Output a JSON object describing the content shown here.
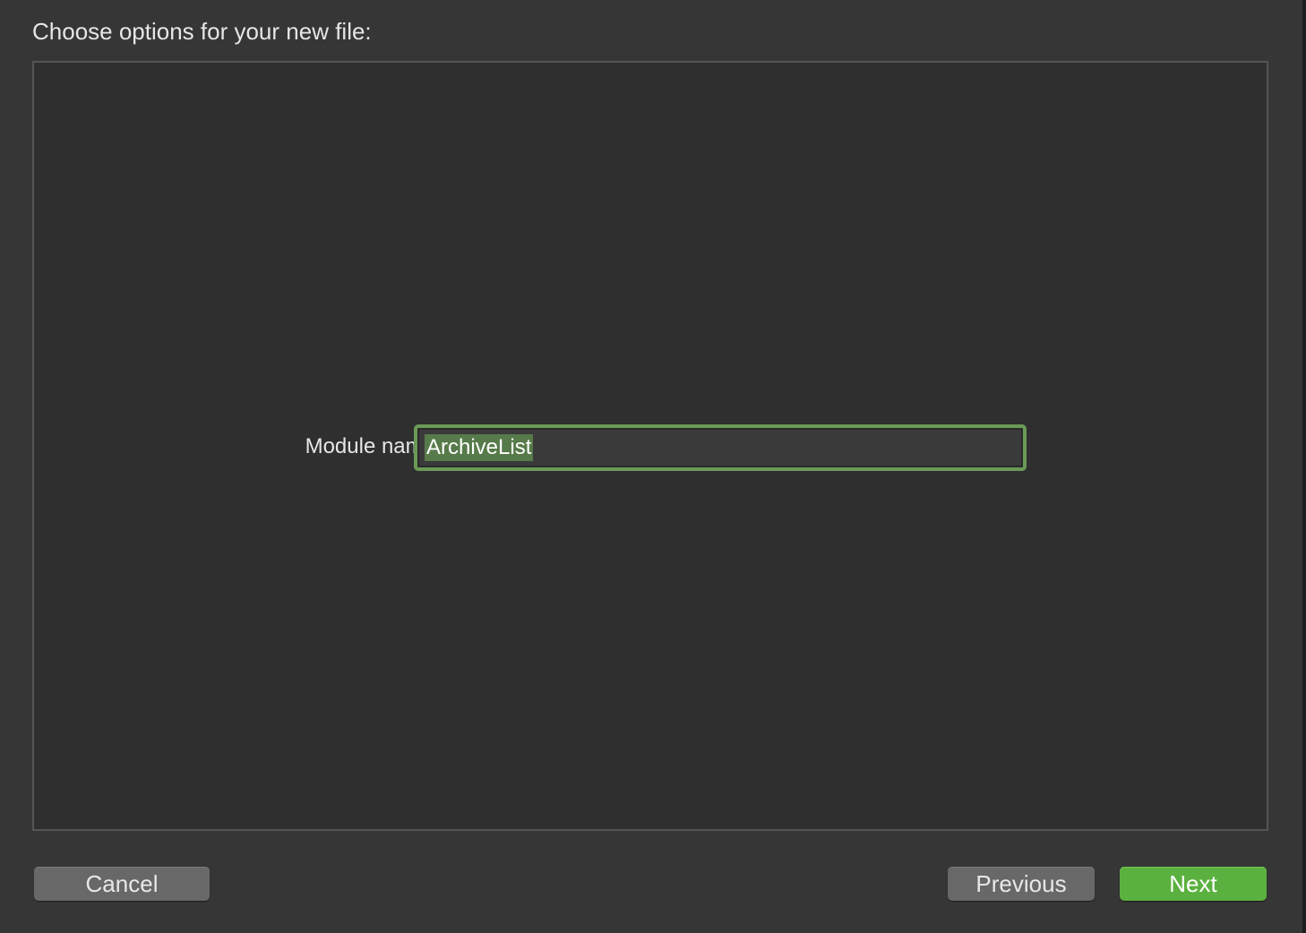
{
  "dialog": {
    "heading": "Choose options for your new file:"
  },
  "form": {
    "module_name_label": "Module name",
    "module_name_value": "ArchiveList"
  },
  "buttons": {
    "cancel": "Cancel",
    "previous": "Previous",
    "next": "Next"
  },
  "colors": {
    "focus_ring": "#6a9a56",
    "selection": "#577a4a",
    "primary_button": "#5bb13f"
  }
}
